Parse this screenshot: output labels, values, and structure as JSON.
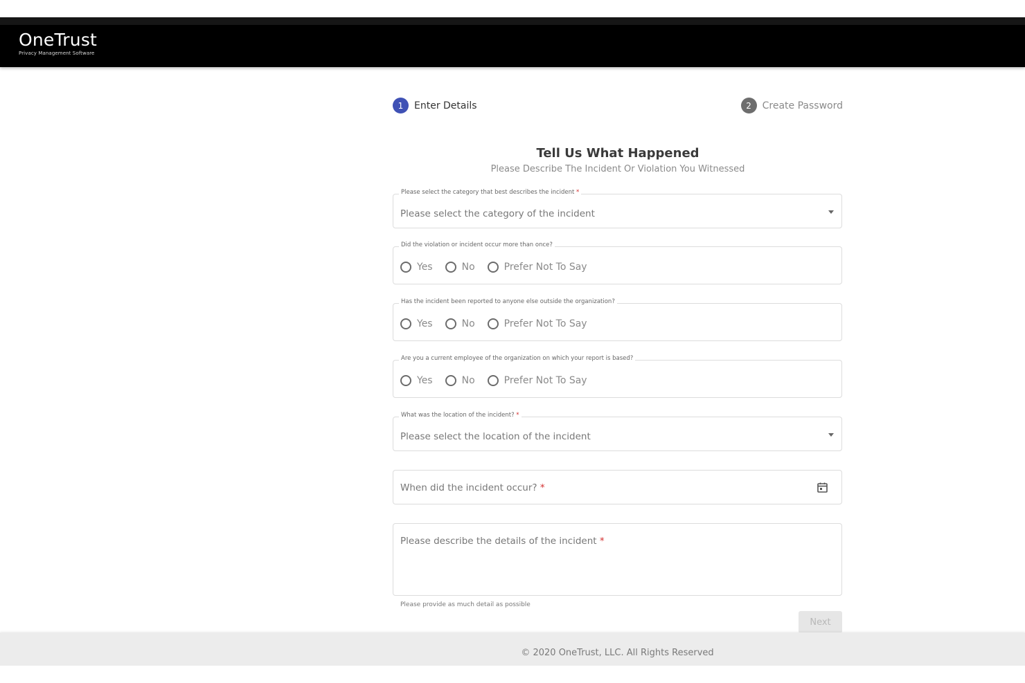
{
  "header": {
    "logo_name": "OneTrust",
    "logo_tagline": "Privacy Management Software"
  },
  "stepper": {
    "steps": [
      {
        "number": "1",
        "label": "Enter Details",
        "state": "active"
      },
      {
        "number": "2",
        "label": "Create Password",
        "state": "inactive"
      }
    ]
  },
  "form": {
    "title": "Tell Us What Happened",
    "subtitle": "Please Describe The Incident Or Violation You Witnessed",
    "category": {
      "label": "Please select the category that best describes the incident",
      "required_mark": "*",
      "value": "Please select the category of the incident"
    },
    "q_more_than_once": {
      "label": "Did the violation or incident occur more than once?",
      "options": [
        "Yes",
        "No",
        "Prefer Not To Say"
      ]
    },
    "q_reported_outside": {
      "label": "Has the incident been reported to anyone else outside the organization?",
      "options": [
        "Yes",
        "No",
        "Prefer Not To Say"
      ]
    },
    "q_current_employee": {
      "label": "Are you a current employee of the organization on which your report is based?",
      "options": [
        "Yes",
        "No",
        "Prefer Not To Say"
      ]
    },
    "location": {
      "label": "What was the location of the incident?",
      "required_mark": "*",
      "value": "Please select the location of the incident"
    },
    "date": {
      "placeholder": "When did the incident occur?",
      "required_mark": "*",
      "icon": "calendar-icon"
    },
    "details": {
      "placeholder": "Please describe the details of the incident",
      "required_mark": "*",
      "helper": "Please provide as much detail as possible"
    },
    "next_label": "Next"
  },
  "footer": {
    "copyright": "© 2020 OneTrust, LLC. All Rights Reserved"
  },
  "colors": {
    "header_bg": "#000000",
    "active_step": "#3f51b5",
    "inactive_step": "#6d6d6d",
    "required": "#d32f2f",
    "footer_bg": "#ececec"
  }
}
